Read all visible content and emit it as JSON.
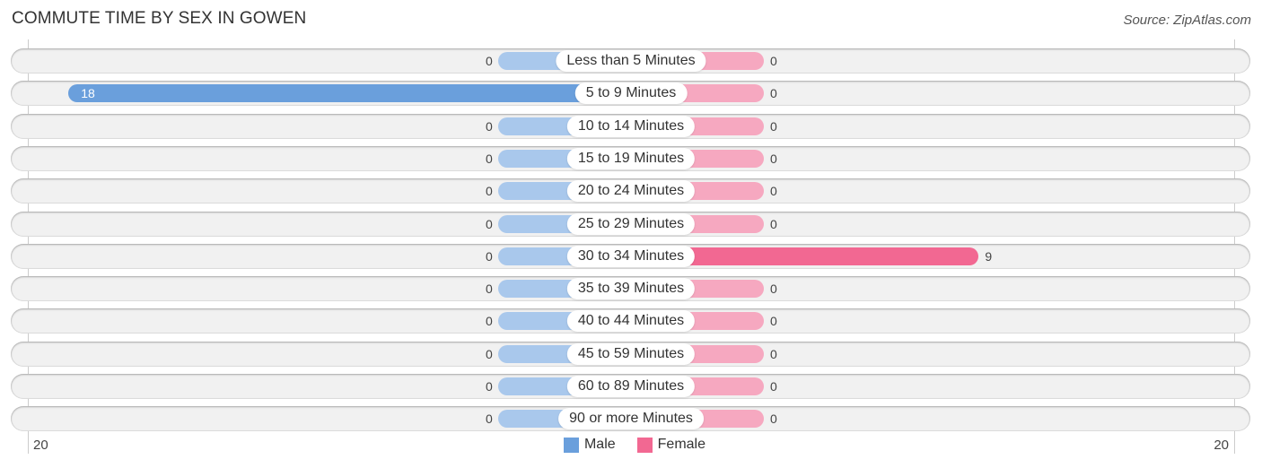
{
  "chart_data": {
    "type": "bar",
    "orientation": "horizontal-diverging",
    "title": "COMMUTE TIME BY SEX IN GOWEN",
    "source": "Source: ZipAtlas.com",
    "categories": [
      "Less than 5 Minutes",
      "5 to 9 Minutes",
      "10 to 14 Minutes",
      "15 to 19 Minutes",
      "20 to 24 Minutes",
      "25 to 29 Minutes",
      "30 to 34 Minutes",
      "35 to 39 Minutes",
      "40 to 44 Minutes",
      "45 to 59 Minutes",
      "60 to 89 Minutes",
      "90 or more Minutes"
    ],
    "series": [
      {
        "name": "Male",
        "color": "#6a9fdc",
        "light_color": "#a9c8ec",
        "values": [
          0,
          18,
          0,
          0,
          0,
          0,
          0,
          0,
          0,
          0,
          0,
          0
        ]
      },
      {
        "name": "Female",
        "color": "#f26892",
        "light_color": "#f6a8c0",
        "values": [
          0,
          0,
          0,
          0,
          0,
          0,
          9,
          0,
          0,
          0,
          0,
          0
        ]
      }
    ],
    "axis": {
      "left_tick": "20",
      "right_tick": "20",
      "range": [
        -20,
        20
      ]
    },
    "legend": {
      "position": "bottom-center",
      "entries": [
        "Male",
        "Female"
      ]
    },
    "grid": false
  }
}
